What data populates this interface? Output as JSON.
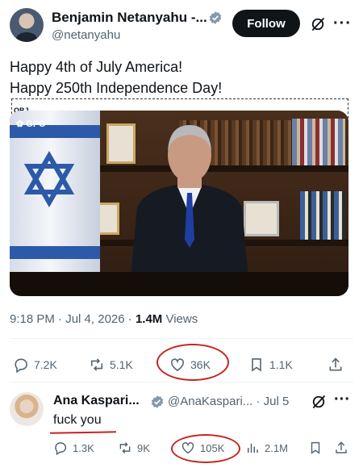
{
  "tweet": {
    "author_name": "Benjamin Netanyahu -...",
    "author_handle": "@netanyahu",
    "follow_label": "Follow",
    "text_line1": "Happy 4th of July America!",
    "text_line2": "Happy 250th Independence Day!",
    "emoji_placeholder": "OBJ",
    "video_watermark": "GPO",
    "time": "9:18 PM",
    "date": "Jul 4, 2026",
    "views_count": "1.4M",
    "views_label": "Views",
    "stats": {
      "replies": "7.2K",
      "retweets": "5.1K",
      "likes": "36K",
      "bookmarks": "1.1K"
    }
  },
  "reply": {
    "author_name": "Ana Kaspari...",
    "author_handle": "@AnaKaspari...",
    "date": "Jul 5",
    "text": "fuck you",
    "stats": {
      "replies": "1.3K",
      "retweets": "9K",
      "likes": "105K",
      "views": "2.1M"
    }
  },
  "colors": {
    "text": "#0f1419",
    "secondary": "#536471",
    "verified": "#829aab",
    "annotation": "#c8231f"
  }
}
